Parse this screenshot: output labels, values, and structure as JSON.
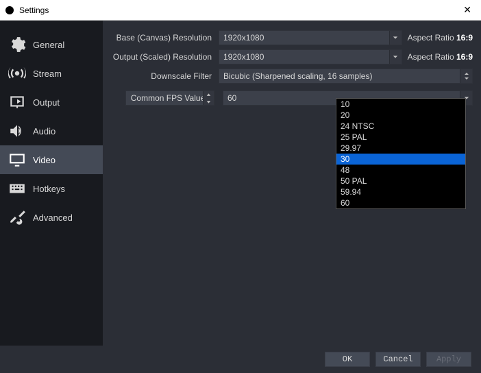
{
  "window": {
    "title": "Settings"
  },
  "sidebar": {
    "items": [
      {
        "label": "General"
      },
      {
        "label": "Stream"
      },
      {
        "label": "Output"
      },
      {
        "label": "Audio"
      },
      {
        "label": "Video"
      },
      {
        "label": "Hotkeys"
      },
      {
        "label": "Advanced"
      }
    ],
    "active_index": 4
  },
  "video": {
    "base_label": "Base (Canvas) Resolution",
    "base_value": "1920x1080",
    "base_ar_label": "Aspect Ratio",
    "base_ar_value": "16:9",
    "output_label": "Output (Scaled) Resolution",
    "output_value": "1920x1080",
    "output_ar_label": "Aspect Ratio",
    "output_ar_value": "16:9",
    "downscale_label": "Downscale Filter",
    "downscale_value": "Bicubic (Sharpened scaling, 16 samples)",
    "fps_mode_label": "Common FPS Values",
    "fps_current": "60",
    "fps_options": [
      "10",
      "20",
      "24 NTSC",
      "25 PAL",
      "29.97",
      "30",
      "48",
      "50 PAL",
      "59.94",
      "60"
    ],
    "fps_highlighted": "30"
  },
  "buttons": {
    "ok": "OK",
    "cancel": "Cancel",
    "apply": "Apply"
  }
}
